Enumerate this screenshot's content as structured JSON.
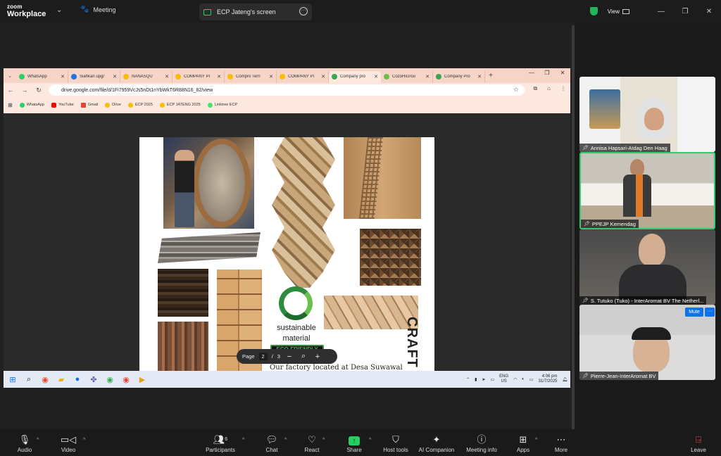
{
  "zoom": {
    "logo_line1": "zoom",
    "logo_line2": "Workplace",
    "meeting_label": "Meeting",
    "share_title": "ECP Jateng's screen",
    "view_label": "View"
  },
  "browser": {
    "tabs": [
      {
        "label": "WhatsApp",
        "color": "#25d366"
      },
      {
        "label": "Siahkan upgr",
        "color": "#1a73e8"
      },
      {
        "label": "NANASQU",
        "color": "#fbbc04"
      },
      {
        "label": "COMPANY PI",
        "color": "#fbbc04"
      },
      {
        "label": "Compro Tern",
        "color": "#fbbc04"
      },
      {
        "label": "COMPANY PI",
        "color": "#fbbc04"
      },
      {
        "label": "Company pro",
        "color": "#34a853"
      },
      {
        "label": "CozoHiGrou",
        "color": "#6abf4b"
      },
      {
        "label": "Company Pro",
        "color": "#34a853"
      }
    ],
    "url": "drive.google.com/file/d/1Fi7959VcJs5nDt1nYbWkT6R88N16_82/view",
    "bookmarks": [
      {
        "label": "WhatsApp",
        "color": "#25d366"
      },
      {
        "label": "YouTube",
        "color": "#ff0000"
      },
      {
        "label": "Gmail",
        "color": "#ea4335"
      },
      {
        "label": "Drive",
        "color": "#fbbc04"
      },
      {
        "label": "ECP 2025",
        "color": "#fbbc04"
      },
      {
        "label": "ECP JATENG 2025",
        "color": "#fbbc04"
      },
      {
        "label": "Linktree ECP",
        "color": "#43e660"
      }
    ]
  },
  "pdf": {
    "sustainable_line1": "sustainable",
    "sustainable_line2": "material",
    "eco_label": "ECO-FRIENDLY",
    "craft_label": "CRAFT",
    "factory_text": "Our factory located at Desa Suwawal",
    "page_label": "Page",
    "current_page": "2",
    "page_sep": "/",
    "total_pages": "3"
  },
  "taskbar": {
    "lang1": "ENG",
    "lang2": "US",
    "time": "4:06 pm",
    "date": "31/7/2025"
  },
  "participants": [
    {
      "name": "Annisa Hapsari-Atdag Den Haag"
    },
    {
      "name": "PPEJP Kemendag"
    },
    {
      "name": "S. Tutuko (Tuko) - InterAromat BV The Netherl..."
    },
    {
      "name": "Pierre-Jean-InterAromat BV"
    }
  ],
  "tile_buttons": {
    "mute": "Mute",
    "more": "···"
  },
  "toolbar": {
    "audio": "Audio",
    "video": "Video",
    "participants": "Participants",
    "participants_count": "6",
    "chat": "Chat",
    "react": "React",
    "share": "Share",
    "host_tools": "Host tools",
    "ai_companion": "AI Companion",
    "meeting_info": "Meeting info",
    "apps": "Apps",
    "more": "More",
    "leave": "Leave"
  }
}
